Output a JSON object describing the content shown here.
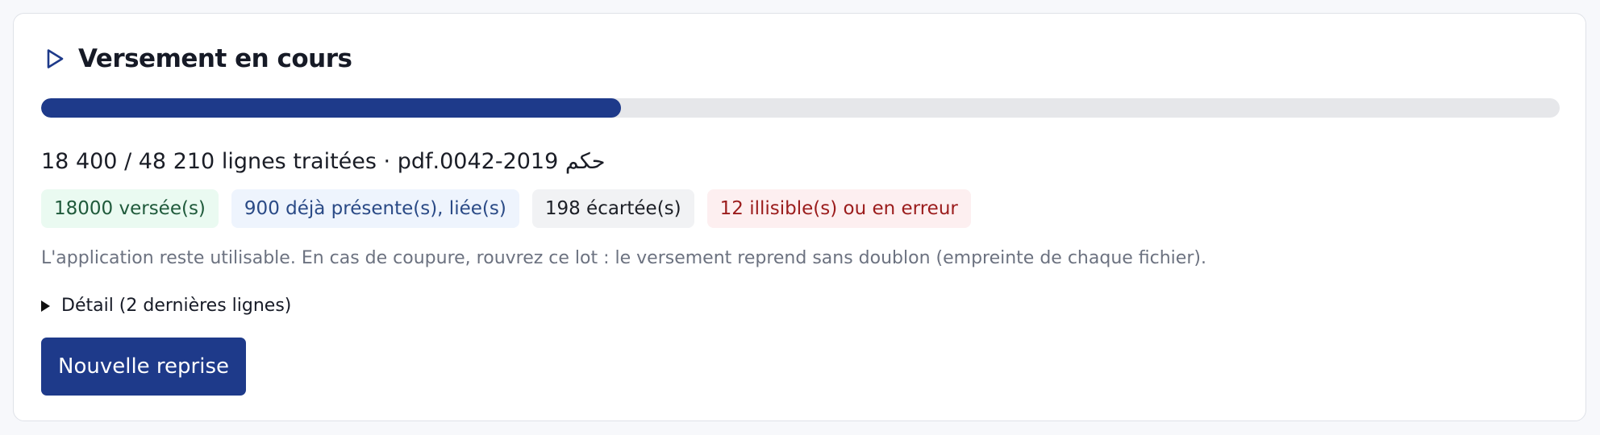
{
  "panel": {
    "title": "Versement en cours",
    "icon": "play-icon",
    "accent": "#1e3a8a"
  },
  "progress": {
    "processed": 18400,
    "total": 48210,
    "fraction": 0.3817
  },
  "counter": {
    "processed_text": "18 400",
    "separator": " / ",
    "total_text": "48 210",
    "suffix": " lignes traitées · ",
    "file_name": "حكم 2019-0042.pdf"
  },
  "badges": [
    {
      "label": "18000 versée(s)",
      "color": "#1f5a3b"
    },
    {
      "label": "900 déjà présente(s), liée(s)",
      "color": "#2a4a86"
    },
    {
      "label": "198 écartée(s)",
      "color": "#1c1f26"
    },
    {
      "label": "12 illisible(s) ou en erreur",
      "color": "#9b1c1c"
    }
  ],
  "note": "L'application reste utilisable. En cas de coupure, rouvrez ce lot : le versement reprend sans doublon (empreinte de chaque fichier).",
  "details": {
    "label": "Détail (2 dernières lignes)"
  },
  "actions": {
    "new_resume_label": "Nouvelle reprise"
  }
}
